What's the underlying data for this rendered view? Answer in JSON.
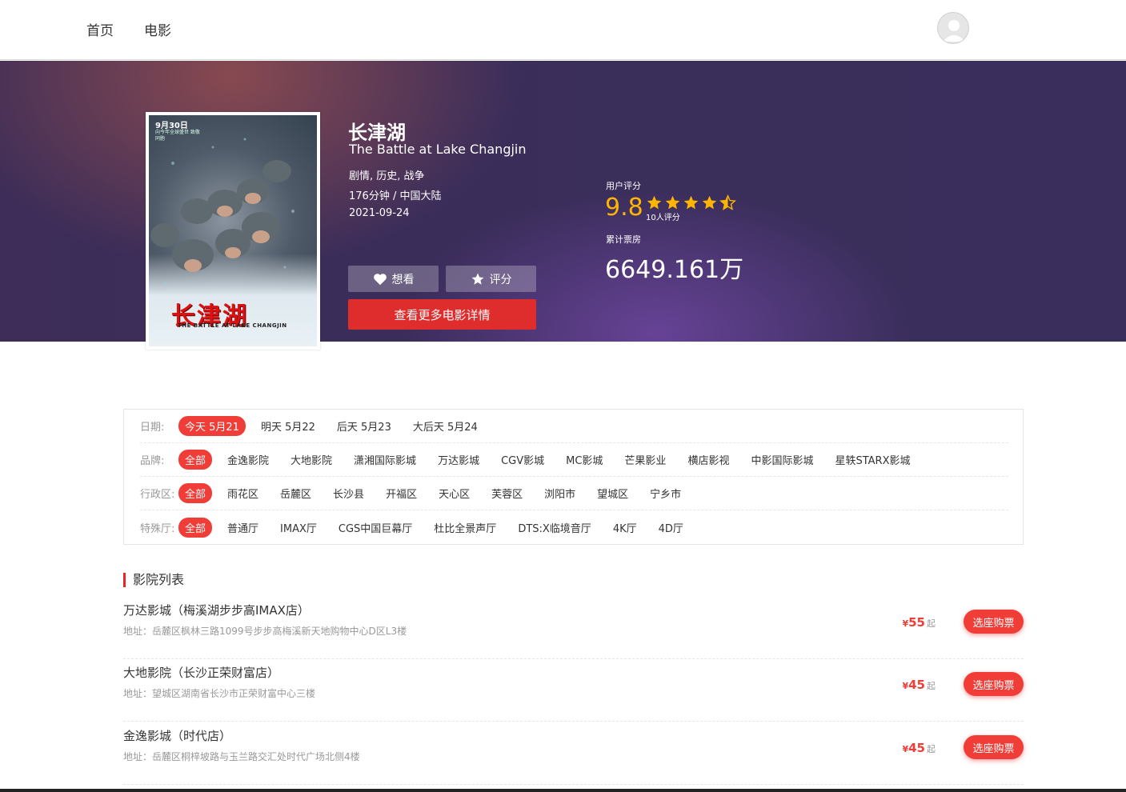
{
  "nav": {
    "home": "首页",
    "movies": "电影"
  },
  "colors": {
    "accent_red": "#df2d2d",
    "tag_red": "#f03d37",
    "star_gold": "#ffb400",
    "banner_purple": "#3a2d5a"
  },
  "movie": {
    "title_cn": "长津湖",
    "title_en": "The Battle at Lake Changjin",
    "genres": "剧情, 历史, 战争",
    "duration_region": "176分钟 / 中国大陆",
    "release_date": "2021-09-24",
    "poster": {
      "date": "9月30日",
      "subtitle": "向今年全球盛世 致敬同胞",
      "title": "长津湖",
      "title_en": "THE BATTLE AT LAKE CHANGJIN"
    },
    "want_label": "想看",
    "rate_label": "评分",
    "details_label": "查看更多电影详情",
    "rating_label": "用户评分",
    "rating_score": "9.8",
    "rating_stars": 4.5,
    "rating_count": "10人评分",
    "box_office_label": "累计票房",
    "box_office": "6649.161万"
  },
  "filters": {
    "date": {
      "label": "日期:",
      "options": [
        "今天 5月21",
        "明天 5月22",
        "后天 5月23",
        "大后天 5月24"
      ],
      "selected": 0
    },
    "brand": {
      "label": "品牌:",
      "options": [
        "全部",
        "金逸影院",
        "大地影院",
        "潇湘国际影城",
        "万达影城",
        "CGV影城",
        "MC影城",
        "芒果影业",
        "横店影视",
        "中影国际影城",
        "星轶STARX影城"
      ],
      "selected": 0
    },
    "district": {
      "label": "行政区:",
      "options": [
        "全部",
        "雨花区",
        "岳麓区",
        "长沙县",
        "开福区",
        "天心区",
        "芙蓉区",
        "浏阳市",
        "望城区",
        "宁乡市"
      ],
      "selected": 0
    },
    "hall": {
      "label": "特殊厅:",
      "options": [
        "全部",
        "普通厅",
        "IMAX厅",
        "CGS中国巨幕厅",
        "杜比全景声厅",
        "DTS:X临境音厅",
        "4K厅",
        "4D厅"
      ],
      "selected": 0
    }
  },
  "cinema_list": {
    "title": "影院列表",
    "buy_label": "选座购票",
    "yen": "¥",
    "qi": "起",
    "items": [
      {
        "name": "万达影城（梅溪湖步步高IMAX店）",
        "address": "地址：岳麓区枫林三路1099号步步高梅溪新天地购物中心D区L3楼",
        "price": "55"
      },
      {
        "name": "大地影院（长沙正荣财富店）",
        "address": "地址：望城区湖南省长沙市正荣财富中心三楼",
        "price": "45"
      },
      {
        "name": "金逸影城（时代店）",
        "address": "地址：岳麓区桐梓坡路与玉兰路交汇处时代广场北侧4楼",
        "price": "45"
      }
    ]
  }
}
